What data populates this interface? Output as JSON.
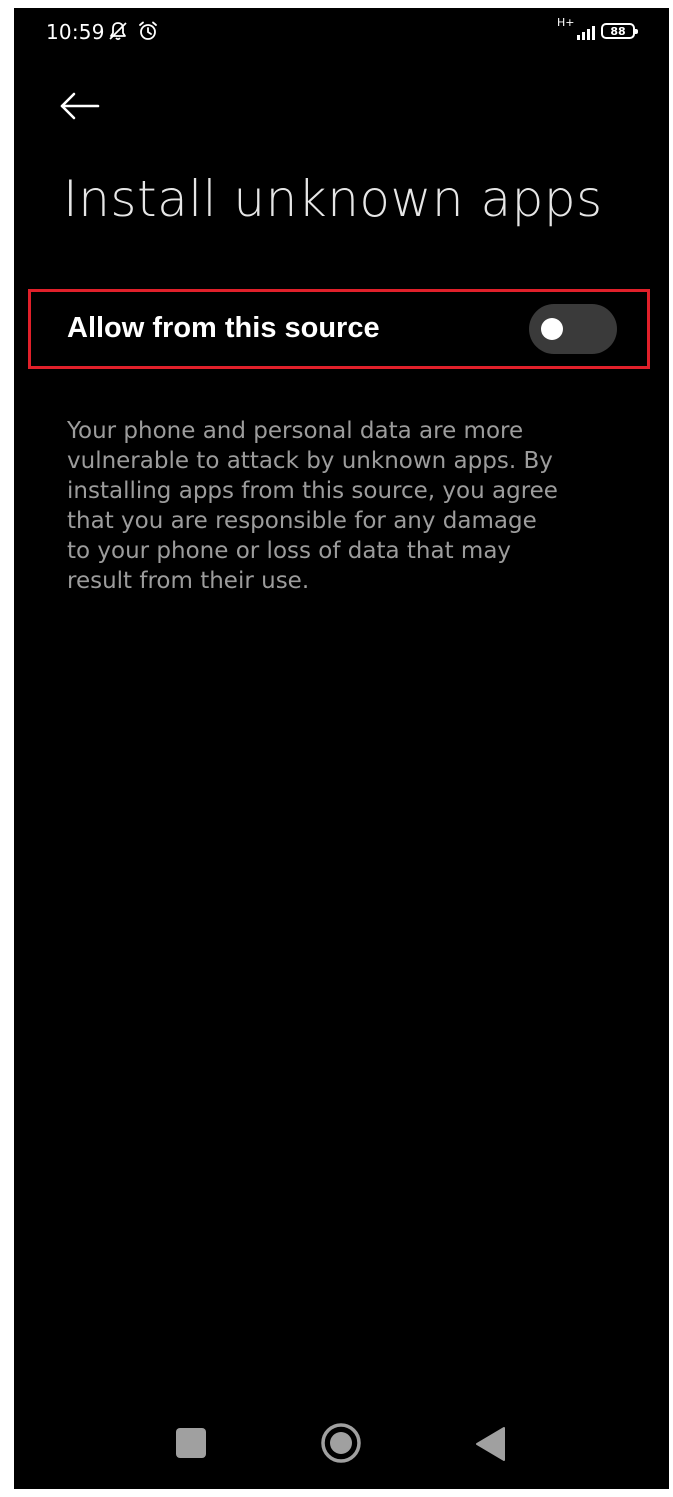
{
  "status_bar": {
    "time": "10:59",
    "left_icons": [
      "notifications-off-icon",
      "alarm-icon"
    ],
    "network_type": "H+",
    "battery_level": "88"
  },
  "header": {
    "back_icon": "arrow-left-icon",
    "title": "Install unknown apps"
  },
  "setting": {
    "label": "Allow from this source",
    "enabled": false,
    "highlight_color": "#e0202a"
  },
  "description": "Your phone and personal data are more vulnerable to attack by unknown apps. By installing apps from this source, you agree that you are responsible for any damage to your phone or loss of data that may result from their use.",
  "nav_bar": {
    "recents_icon": "square-icon",
    "home_icon": "circle-icon",
    "back_icon": "triangle-back-icon"
  },
  "colors": {
    "background": "#000000",
    "title": "#e6e6e6",
    "label": "#ffffff",
    "description": "#9c9c9c",
    "toggle_track": "#3a3a3a",
    "toggle_knob": "#ffffff"
  }
}
